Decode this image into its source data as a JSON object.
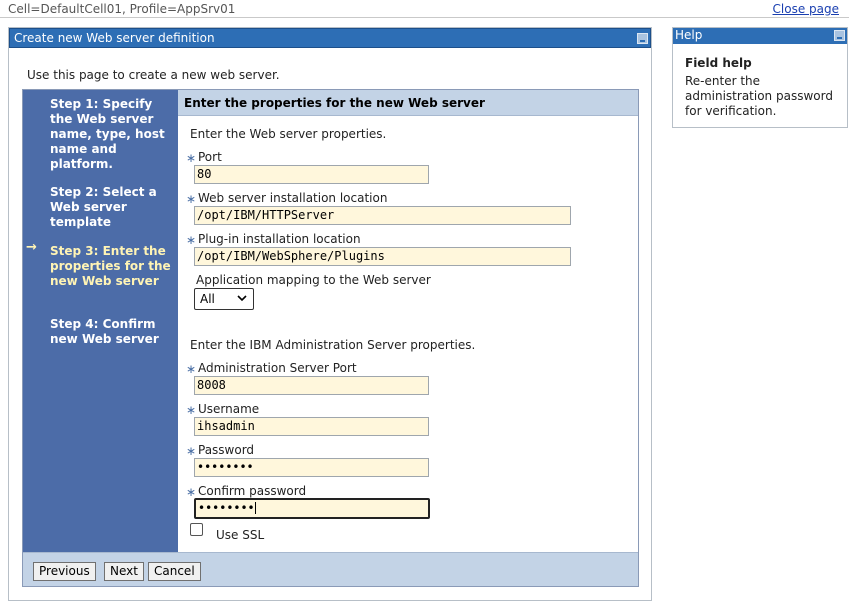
{
  "top": {
    "cell_info": "Cell=DefaultCell01, Profile=AppSrv01",
    "close_page": "Close page"
  },
  "portlet": {
    "title": "Create new Web server definition",
    "intro": "Use this page to create a new web server."
  },
  "steps": [
    {
      "label": "Step 1: Specify the Web server name, type, host name and platform.",
      "current": false
    },
    {
      "label": "Step 2: Select a Web server template",
      "current": false
    },
    {
      "label": "Step 3: Enter the properties for the new Web server",
      "current": true
    },
    {
      "label": "Step 4: Confirm new Web server",
      "current": false
    }
  ],
  "current_step_marker": "→",
  "form": {
    "heading": "Enter the properties for the new Web server",
    "web_section_label": "Enter the Web server properties.",
    "required_marker": "∗",
    "port_label": "Port",
    "port_value": "80",
    "install_location_label": "Web server installation location",
    "install_location_value": "/opt/IBM/HTTPServer",
    "plugin_location_label": "Plug-in installation location",
    "plugin_location_value": "/opt/IBM/WebSphere/Plugins",
    "app_mapping_label": "Application mapping to the Web server",
    "app_mapping_value": "All",
    "admin_section_label": "Enter the IBM Administration Server properties.",
    "admin_port_label": "Administration Server Port",
    "admin_port_value": "8008",
    "username_label": "Username",
    "username_value": "ihsadmin",
    "password_label": "Password",
    "password_value": "••••••••",
    "confirm_password_label": "Confirm password",
    "confirm_password_value": "••••••••",
    "use_ssl_label": "Use SSL",
    "use_ssl_checked": false
  },
  "buttons": {
    "previous": "Previous",
    "next": "Next",
    "cancel": "Cancel"
  },
  "help": {
    "title": "Help",
    "heading": "Field help",
    "text": "Re-enter the administration password for verification."
  },
  "colors": {
    "title_bar": "#2d6eb5",
    "step_panel": "#4c6ca8",
    "current_step": "#fff4b5",
    "input_bg": "#fff7dc",
    "form_header": "#c3d3e6"
  }
}
